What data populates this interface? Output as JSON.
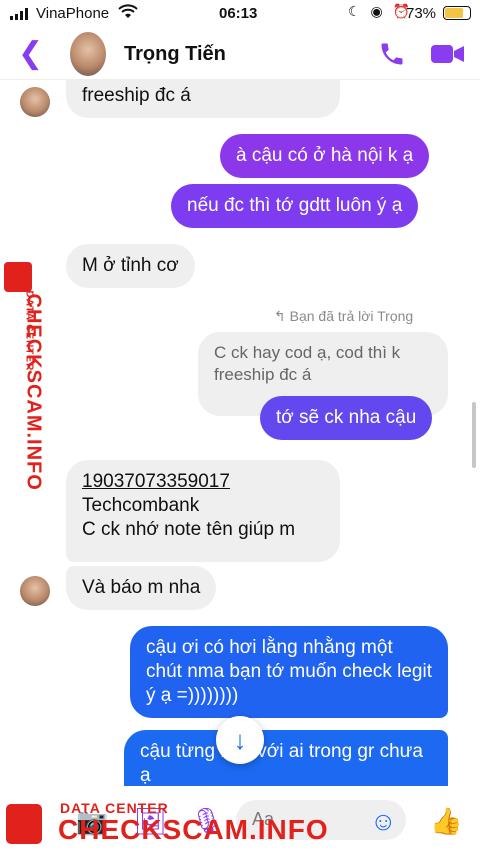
{
  "status_bar": {
    "carrier": "VinaPhone",
    "time": "06:13",
    "battery": "73%"
  },
  "header": {
    "contact_name": "Trọng Tiến"
  },
  "chat": {
    "messages": [
      {
        "side": "in",
        "text": "freeship đc á"
      },
      {
        "side": "out",
        "text": "à cậu có ở hà nội k ạ",
        "color": "#8c38ea"
      },
      {
        "side": "out",
        "text": "nếu đc thì tớ gdtt luôn ý ạ",
        "color": "#7d3cf0"
      },
      {
        "side": "in",
        "text": "M ở tỉnh cơ"
      },
      {
        "reply_note": "Bạn đã trả lời Trọng"
      },
      {
        "side": "in",
        "text": "C ck hay cod ạ, cod thì k freeship đc á",
        "muted": true
      },
      {
        "side": "out",
        "text": "tớ sẽ ck nha cậu",
        "color": "#6248ee"
      },
      {
        "side": "in",
        "account_number": "19037073359017",
        "bank": "Techcombank",
        "note": "C ck nhớ note tên giúp m"
      },
      {
        "side": "in",
        "text": "Và báo m nha"
      },
      {
        "side": "out",
        "text": "cậu ơi có hơi lằng nhằng một chút nma bạn tớ muốn check legit ý ạ =))))))))",
        "color": "#2163f1"
      },
      {
        "side": "out",
        "text": "cậu từng bán với ai trong gr chưa ạ",
        "color": "#1d6af2"
      }
    ]
  },
  "composer": {
    "placeholder": "Aa"
  },
  "watermark": {
    "sub": "DATA CENTER",
    "brand": "CHECKSCAM.INFO"
  },
  "icons": [
    "back-icon",
    "phone-icon",
    "video-camera-icon",
    "camera-icon",
    "image-icon",
    "microphone-icon",
    "emoji-icon",
    "thumbs-up-icon",
    "arrow-down-icon",
    "reply-icon"
  ]
}
